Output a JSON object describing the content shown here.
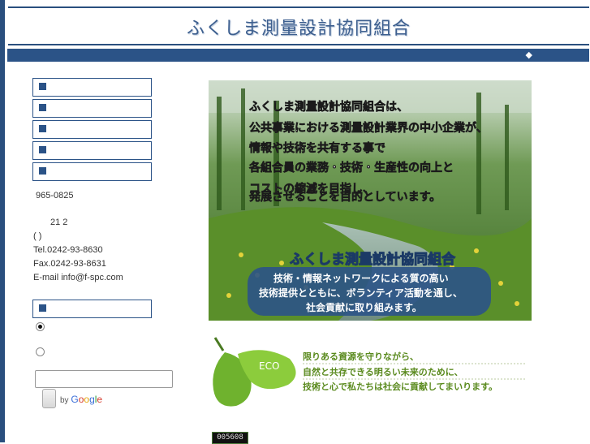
{
  "site": {
    "title": "ふくしま測量設計協同組合"
  },
  "navbar": {
    "mark": "◆"
  },
  "menu": {
    "items": [
      "",
      "",
      "",
      "",
      ""
    ]
  },
  "address": {
    "postal": "965-0825",
    "line2": "21 2",
    "line3": "( )",
    "tel": "Tel.0242-93-8630",
    "fax": "Fax.0242-93-8631",
    "email": "E-mail info@f-spc.com"
  },
  "search": {
    "input_value": "",
    "by_label": "by",
    "brand": [
      "G",
      "o",
      "o",
      "g",
      "l",
      "e"
    ]
  },
  "hero": {
    "lines": [
      "ふくしま測量設計協同組合は、",
      "公共事業における測量設計業界の中小企業が、",
      "情報や技術を共有する事で",
      "各組合員の業務・技術・生産性の向上と",
      "コストの縮減を目指し、",
      "発展させることを目的としています。"
    ],
    "banner_title": "ふくしま測量設計協同組合",
    "banner_lines": [
      "技術・情報ネットワークによる質の高い",
      "技術提供とともに、ボランティア活動を通し、",
      "社会貢献に取り組みます。"
    ]
  },
  "eco": {
    "badge": "ECO",
    "lines": [
      "限りある資源を守りながら、",
      "自然と共存できる明るい未来のために、",
      "技術と心で私たちは社会に貢献してまいります。"
    ]
  },
  "counter": {
    "value": "005608"
  },
  "colors": {
    "brand": "#2b5387",
    "eco_text": "#5a8a1e"
  }
}
